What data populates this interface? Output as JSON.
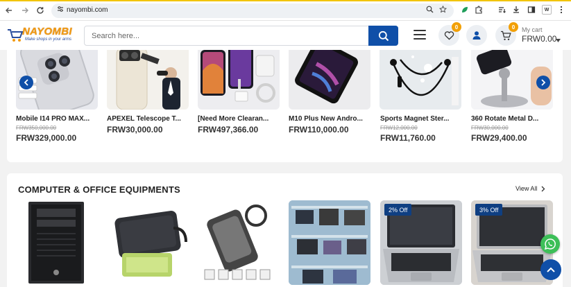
{
  "browser": {
    "url": "nayombi.com",
    "profile_badge": "W"
  },
  "header": {
    "logo_name": "NAYOMBI",
    "logo_tagline": "Make shops in your arms",
    "search_placeholder": "Search here...",
    "wishlist_count": "0",
    "cart_count": "0",
    "cart_label": "My cart",
    "cart_total": "FRW0.00"
  },
  "carousel": {
    "products": [
      {
        "name": "Mobile I14 PRO MAX...",
        "old_price": "FRW350,000.00",
        "price": "FRW329,000.00"
      },
      {
        "name": "APEXEL Telescope T...",
        "old_price": "",
        "price": "FRW30,000.00"
      },
      {
        "name": "[Need More Clearan...",
        "old_price": "",
        "price": "FRW497,366.00"
      },
      {
        "name": "M10 Plus New Andro...",
        "old_price": "",
        "price": "FRW110,000.00"
      },
      {
        "name": "Sports Magnet Ster...",
        "old_price": "FRW12,000.00",
        "price": "FRW11,760.00"
      },
      {
        "name": "360 Rotate Metal D...",
        "old_price": "FRW30,000.00",
        "price": "FRW29,400.00"
      }
    ]
  },
  "section": {
    "title": "COMPUTER & OFFICE EQUIPMENTS",
    "view_all": "View All",
    "badges": [
      "2% Off",
      "3% Off"
    ]
  },
  "colors": {
    "brand_blue": "#0f4fa8",
    "badge_orange": "#f2a007",
    "logo_orange": "#f29a12",
    "whatsapp_green": "#3dbf58"
  },
  "icons": [
    "back-arrow-icon",
    "forward-arrow-icon",
    "reload-icon",
    "site-settings-icon",
    "zoom-icon",
    "bookmark-star-icon",
    "extension-icon",
    "download-icon",
    "search-icon",
    "menu-icon",
    "heart-icon",
    "user-icon",
    "cart-icon",
    "chevron-left-icon",
    "chevron-right-icon",
    "whatsapp-icon",
    "arrow-up-icon"
  ]
}
